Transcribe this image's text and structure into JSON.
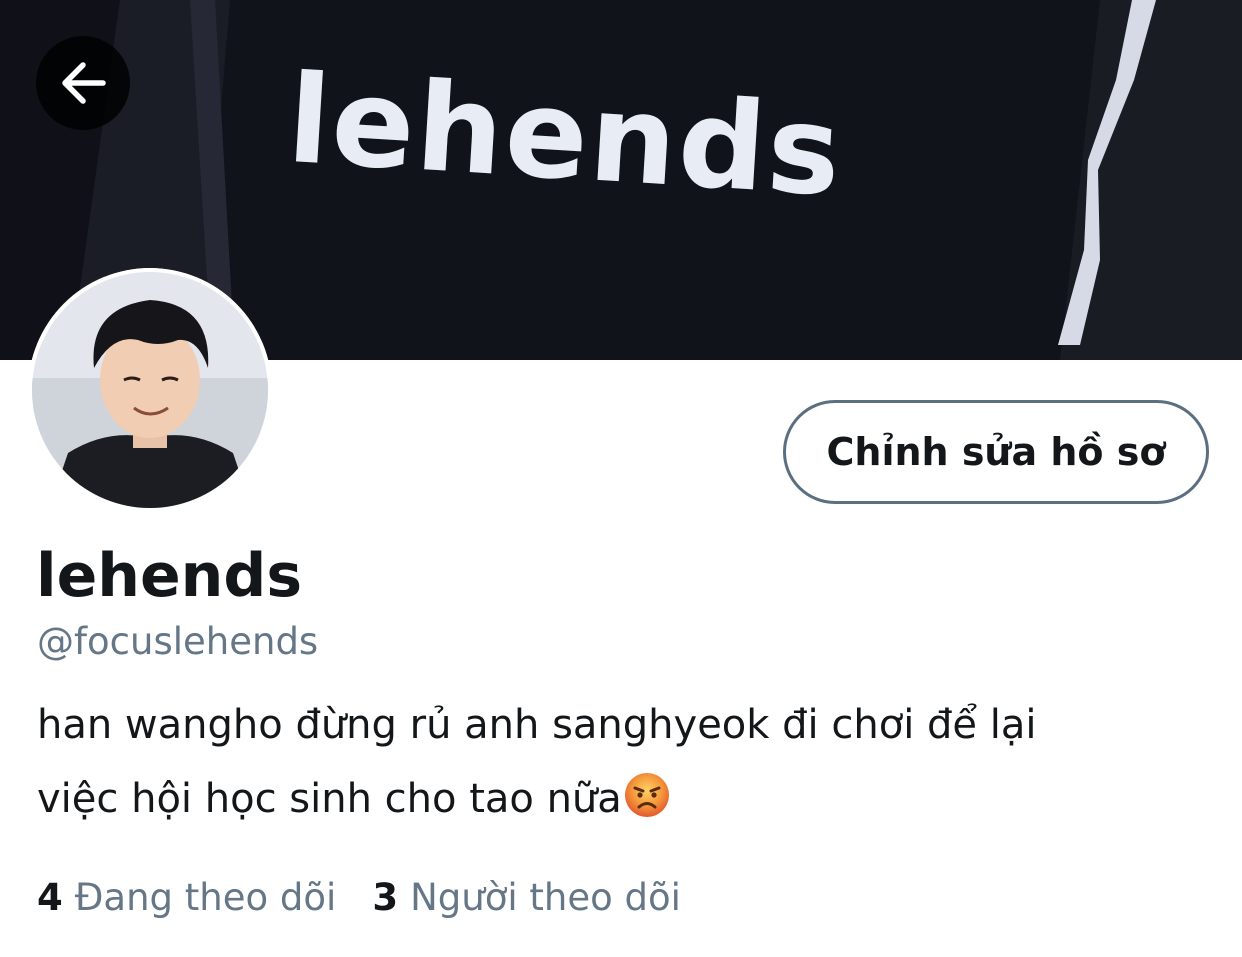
{
  "banner": {
    "text": "lehends",
    "colors": {
      "background": "#11131a",
      "text": "#e8ecf4"
    }
  },
  "nav": {
    "back_icon": "arrow-left-icon"
  },
  "profile": {
    "edit_button_label": "Chỉnh sửa hồ sơ",
    "display_name": "lehends",
    "handle": "@focuslehends",
    "bio_line1": "han wangho đừng rủ anh sanghyeok đi chơi để lại",
    "bio_line2": "việc hội học sinh cho tao nữa",
    "bio_emoji": "angry-face-icon"
  },
  "stats": {
    "following_count": "4",
    "following_label": "Đang theo dõi",
    "followers_count": "3",
    "followers_label": "Người theo dõi"
  },
  "colors": {
    "text_primary": "#14171a",
    "text_secondary": "#657786",
    "button_border": "#5b6f80"
  }
}
